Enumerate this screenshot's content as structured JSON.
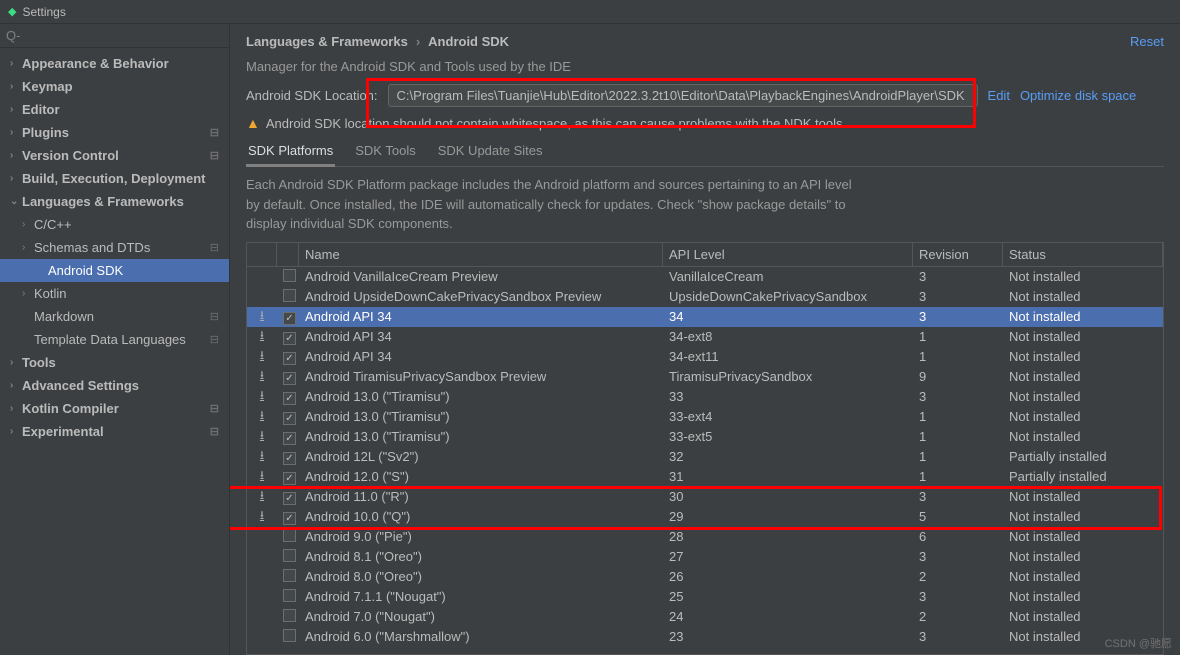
{
  "window": {
    "title": "Settings"
  },
  "search": {
    "placeholder": ""
  },
  "sidebar": {
    "items": [
      {
        "label": "Appearance & Behavior",
        "type": "top"
      },
      {
        "label": "Keymap",
        "type": "top"
      },
      {
        "label": "Editor",
        "type": "top"
      },
      {
        "label": "Plugins",
        "type": "top",
        "sep": true
      },
      {
        "label": "Version Control",
        "type": "top",
        "sep": true
      },
      {
        "label": "Build, Execution, Deployment",
        "type": "top"
      },
      {
        "label": "Languages & Frameworks",
        "type": "top",
        "expanded": true
      },
      {
        "label": "C/C++",
        "type": "child",
        "chev": "›"
      },
      {
        "label": "Schemas and DTDs",
        "type": "child",
        "chev": "›",
        "sep": true
      },
      {
        "label": "Android SDK",
        "type": "gchild",
        "selected": true
      },
      {
        "label": "Kotlin",
        "type": "child",
        "chev": "›"
      },
      {
        "label": "Markdown",
        "type": "child",
        "sep": true
      },
      {
        "label": "Template Data Languages",
        "type": "child",
        "sep": true
      },
      {
        "label": "Tools",
        "type": "top"
      },
      {
        "label": "Advanced Settings",
        "type": "top"
      },
      {
        "label": "Kotlin Compiler",
        "type": "top",
        "sep": true
      },
      {
        "label": "Experimental",
        "type": "top",
        "sep": true
      }
    ]
  },
  "breadcrumb": {
    "a": "Languages & Frameworks",
    "b": "Android SDK"
  },
  "actions": {
    "reset": "Reset",
    "edit": "Edit",
    "optimize": "Optimize disk space"
  },
  "description": "Manager for the Android SDK and Tools used by the IDE",
  "location": {
    "label": "Android SDK Location:",
    "value": "C:\\Program Files\\Tuanjie\\Hub\\Editor\\2022.3.2t10\\Editor\\Data\\PlaybackEngines\\AndroidPlayer\\SDK"
  },
  "warning": "Android SDK location should not contain whitespace, as this can cause problems with the NDK tools.",
  "tabs": [
    "SDK Platforms",
    "SDK Tools",
    "SDK Update Sites"
  ],
  "activeTab": 0,
  "tabDescription": "Each Android SDK Platform package includes the Android platform and sources pertaining to an API level by default. Once installed, the IDE will automatically check for updates. Check \"show package details\" to display individual SDK components.",
  "columns": {
    "name": "Name",
    "api": "API Level",
    "rev": "Revision",
    "status": "Status"
  },
  "rows": [
    {
      "dl": false,
      "checked": false,
      "name": "Android VanillaIceCream Preview",
      "api": "VanillaIceCream",
      "rev": "3",
      "status": "Not installed"
    },
    {
      "dl": false,
      "checked": false,
      "name": "Android UpsideDownCakePrivacySandbox Preview",
      "api": "UpsideDownCakePrivacySandbox",
      "rev": "3",
      "status": "Not installed"
    },
    {
      "dl": true,
      "checked": true,
      "name": "Android API 34",
      "api": "34",
      "rev": "3",
      "status": "Not installed",
      "selected": true
    },
    {
      "dl": true,
      "checked": true,
      "name": "Android API 34",
      "api": "34-ext8",
      "rev": "1",
      "status": "Not installed"
    },
    {
      "dl": true,
      "checked": true,
      "name": "Android API 34",
      "api": "34-ext11",
      "rev": "1",
      "status": "Not installed"
    },
    {
      "dl": true,
      "checked": true,
      "name": "Android TiramisuPrivacySandbox Preview",
      "api": "TiramisuPrivacySandbox",
      "rev": "9",
      "status": "Not installed"
    },
    {
      "dl": true,
      "checked": true,
      "name": "Android 13.0 (\"Tiramisu\")",
      "api": "33",
      "rev": "3",
      "status": "Not installed"
    },
    {
      "dl": true,
      "checked": true,
      "name": "Android 13.0 (\"Tiramisu\")",
      "api": "33-ext4",
      "rev": "1",
      "status": "Not installed"
    },
    {
      "dl": true,
      "checked": true,
      "name": "Android 13.0 (\"Tiramisu\")",
      "api": "33-ext5",
      "rev": "1",
      "status": "Not installed"
    },
    {
      "dl": true,
      "checked": true,
      "name": "Android 12L (\"Sv2\")",
      "api": "32",
      "rev": "1",
      "status": "Partially installed"
    },
    {
      "dl": true,
      "checked": true,
      "name": "Android 12.0 (\"S\")",
      "api": "31",
      "rev": "1",
      "status": "Partially installed"
    },
    {
      "dl": true,
      "checked": true,
      "name": "Android 11.0 (\"R\")",
      "api": "30",
      "rev": "3",
      "status": "Not installed"
    },
    {
      "dl": true,
      "checked": true,
      "name": "Android 10.0 (\"Q\")",
      "api": "29",
      "rev": "5",
      "status": "Not installed"
    },
    {
      "dl": false,
      "checked": false,
      "name": "Android 9.0 (\"Pie\")",
      "api": "28",
      "rev": "6",
      "status": "Not installed"
    },
    {
      "dl": false,
      "checked": false,
      "name": "Android 8.1 (\"Oreo\")",
      "api": "27",
      "rev": "3",
      "status": "Not installed"
    },
    {
      "dl": false,
      "checked": false,
      "name": "Android 8.0 (\"Oreo\")",
      "api": "26",
      "rev": "2",
      "status": "Not installed"
    },
    {
      "dl": false,
      "checked": false,
      "name": "Android 7.1.1 (\"Nougat\")",
      "api": "25",
      "rev": "3",
      "status": "Not installed"
    },
    {
      "dl": false,
      "checked": false,
      "name": "Android 7.0 (\"Nougat\")",
      "api": "24",
      "rev": "2",
      "status": "Not installed"
    },
    {
      "dl": false,
      "checked": false,
      "name": "Android 6.0 (\"Marshmallow\")",
      "api": "23",
      "rev": "3",
      "status": "Not installed"
    }
  ],
  "watermark": "CSDN @驰愿"
}
